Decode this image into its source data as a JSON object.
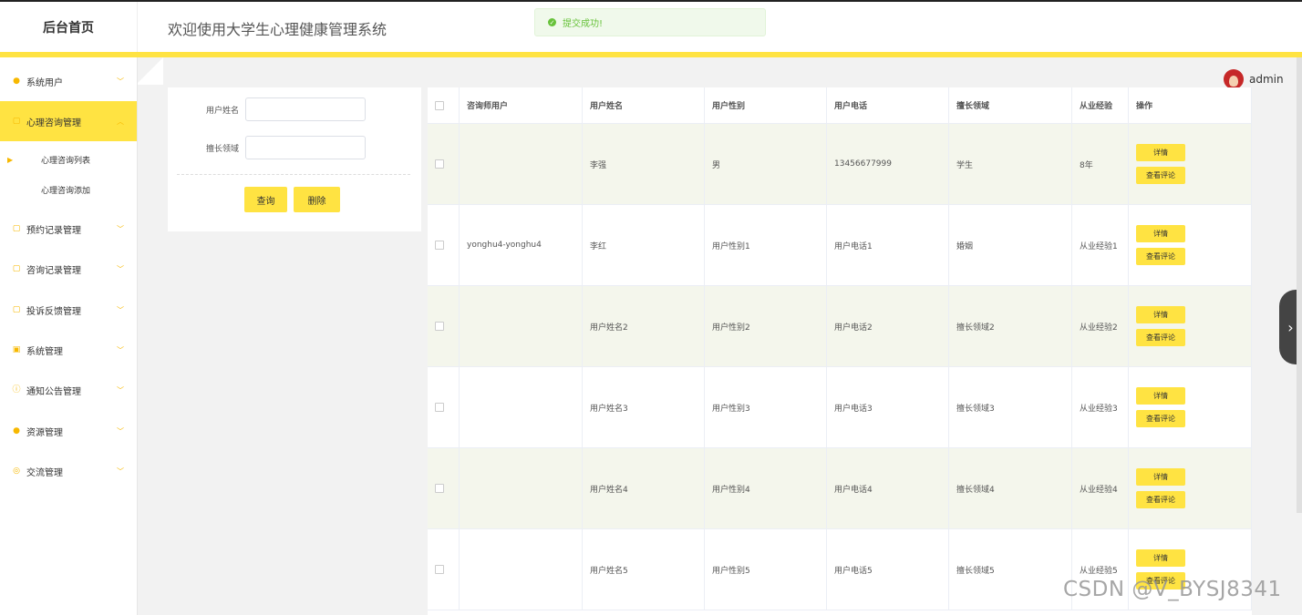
{
  "app": {
    "brand": "后台首页",
    "header_title": "欢迎使用大学生心理健康管理系统",
    "toast": {
      "icon": "check-circle-icon",
      "text": "提交成功!"
    },
    "user": {
      "name": "admin",
      "avatar": "avatar"
    }
  },
  "sidebar": {
    "items": [
      {
        "label": "系统用户",
        "icon": "user-icon"
      },
      {
        "label": "心理咨询管理",
        "icon": "folder-icon",
        "active": true
      },
      {
        "label": "预约记录管理",
        "icon": "folder-icon"
      },
      {
        "label": "咨询记录管理",
        "icon": "folder-icon"
      },
      {
        "label": "投诉反馈管理",
        "icon": "folder-icon"
      },
      {
        "label": "系统管理",
        "icon": "image-icon"
      },
      {
        "label": "通知公告管理",
        "icon": "info-icon"
      },
      {
        "label": "资源管理",
        "icon": "location-icon"
      },
      {
        "label": "交流管理",
        "icon": "chat-icon"
      }
    ],
    "subitems": [
      {
        "label": "心理咨询列表",
        "active": true
      },
      {
        "label": "心理咨询添加"
      }
    ]
  },
  "search": {
    "fields": [
      {
        "label": "用户姓名",
        "value": ""
      },
      {
        "label": "擅长领域",
        "value": ""
      }
    ],
    "query_label": "查询",
    "delete_label": "删除"
  },
  "table": {
    "columns": [
      "咨询师用户",
      "用户姓名",
      "用户性别",
      "用户电话",
      "擅长领域",
      "从业经验",
      "操作"
    ],
    "rows": [
      [
        "",
        "李强",
        "男",
        "13456677999",
        "学生",
        "8年"
      ],
      [
        "yonghu4-yonghu4",
        "李红",
        "用户性别1",
        "用户电话1",
        "婚姻",
        "从业经验1"
      ],
      [
        "",
        "用户姓名2",
        "用户性别2",
        "用户电话2",
        "擅长领域2",
        "从业经验2"
      ],
      [
        "",
        "用户姓名3",
        "用户性别3",
        "用户电话3",
        "擅长领域3",
        "从业经验3"
      ],
      [
        "",
        "用户姓名4",
        "用户性别4",
        "用户电话4",
        "擅长领域4",
        "从业经验4"
      ],
      [
        "",
        "用户姓名5",
        "用户性别5",
        "用户电话5",
        "擅长领域5",
        "从业经验5"
      ]
    ],
    "detail_label": "详情",
    "comment_label": "查看评论"
  },
  "watermark": "CSDN @V_BYSJ8341",
  "colors": {
    "accent": "#ffe342",
    "success": "#67c23a",
    "icon": "#f7b800"
  }
}
